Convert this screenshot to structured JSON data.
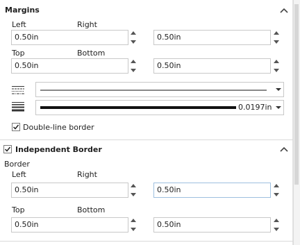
{
  "margins": {
    "title": "Margins",
    "left_label": "Left",
    "right_label": "Right",
    "top_label": "Top",
    "bottom_label": "Bottom",
    "left_value": "0.50in",
    "right_value": "0.50in",
    "top_value": "0.50in",
    "bottom_value": "0.50in"
  },
  "line_style": {
    "icon": "line-style-icon",
    "selected": "solid-thin-line"
  },
  "line_weight": {
    "icon": "line-weight-icon",
    "value": "0.0197in"
  },
  "double_line": {
    "label": "Double-line border",
    "checked": true
  },
  "independent": {
    "title": "Independent Border",
    "checked": true,
    "border_label": "Border",
    "left_label": "Left",
    "right_label": "Right",
    "top_label": "Top",
    "bottom_label": "Bottom",
    "left_value": "0.50in",
    "right_value": "0.50in",
    "top_value": "0.50in",
    "bottom_value": "0.50in"
  },
  "colors": {
    "border": "#c8c8c8",
    "focus_border": "#9dbfdf",
    "text": "#1e1e1e"
  }
}
